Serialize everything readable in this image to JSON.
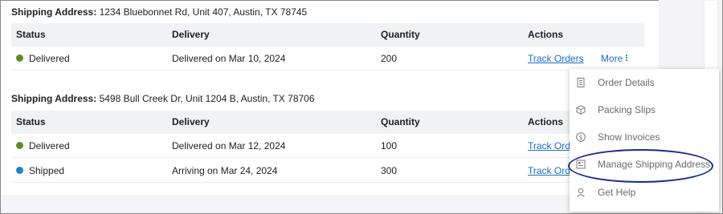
{
  "sections": [
    {
      "address_label": "Shipping Address:",
      "address_value": "1234 Bluebonnet Rd, Unit 407, Austin, TX 78745",
      "columns": [
        "Status",
        "Delivery",
        "Quantity",
        "Actions"
      ],
      "rows": [
        {
          "status": "Delivered",
          "status_color": "#5a8f21",
          "delivery": "Delivered on Mar 10, 2024",
          "quantity": "200",
          "action_link": "Track Orders",
          "more_label": "More"
        }
      ]
    },
    {
      "address_label": "Shipping Address:",
      "address_value": "5498 Bull Creek Dr, Unit 1204 B, Austin, TX 78706",
      "columns": [
        "Status",
        "Delivery",
        "Quantity",
        "Actions"
      ],
      "rows": [
        {
          "status": "Delivered",
          "status_color": "#5a8f21",
          "delivery": "Delivered on Mar 12, 2024",
          "quantity": "100",
          "action_link": "Track Orde"
        },
        {
          "status": "Shipped",
          "status_color": "#1f7fd6",
          "delivery": "Arriving on Mar 24, 2024",
          "quantity": "300",
          "action_link": "Track Orde"
        }
      ]
    }
  ],
  "dropdown_menu": {
    "items": [
      {
        "label": "Order Details",
        "icon": "document-icon"
      },
      {
        "label": "Packing Slips",
        "icon": "box-icon"
      },
      {
        "label": "Show Invoices",
        "icon": "dollar-icon"
      },
      {
        "label": "Manage Shipping Address",
        "icon": "address-card-icon",
        "highlighted": true
      },
      {
        "label": "Get Help",
        "icon": "help-person-icon"
      }
    ]
  },
  "colors": {
    "link": "#1a6fc4",
    "header_bg": "#f1f2f4",
    "highlight_ring": "#1a2a8f"
  }
}
